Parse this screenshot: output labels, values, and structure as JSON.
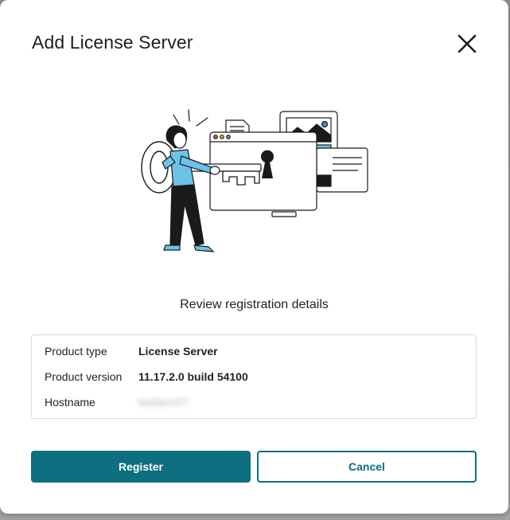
{
  "dialog": {
    "title": "Add License Server",
    "close_icon": "close-icon",
    "illustration_icon": "person-key-browser-illustration",
    "subtitle": "Review registration details"
  },
  "details": {
    "rows": [
      {
        "label": "Product type",
        "value": "License Server"
      },
      {
        "label": "Product version",
        "value": "11.17.2.0 build 54100"
      },
      {
        "label": "Hostname",
        "value": "lsbldsrv07"
      }
    ]
  },
  "actions": {
    "register_label": "Register",
    "cancel_label": "Cancel"
  },
  "colors": {
    "accent": "#0d6f80",
    "illustration_blue": "#6cc3e8"
  }
}
